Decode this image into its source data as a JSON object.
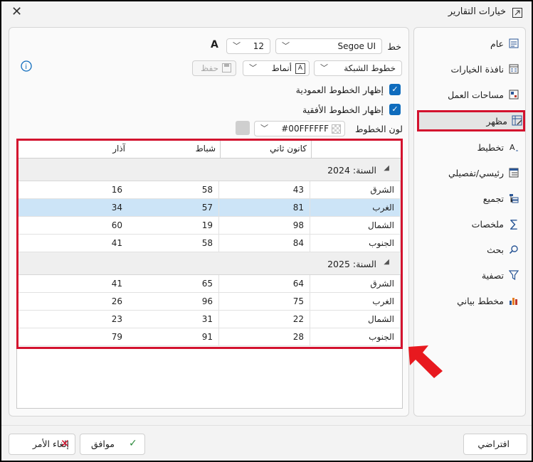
{
  "window": {
    "title": "خيارات التقارير"
  },
  "sidebar": {
    "items": [
      {
        "label": "عام",
        "icon": "general-settings-icon"
      },
      {
        "label": "نافذة الخيارات",
        "icon": "options-window-icon"
      },
      {
        "label": "مساحات العمل",
        "icon": "workspaces-icon"
      },
      {
        "label": "مظهر",
        "icon": "appearance-icon",
        "active": true
      },
      {
        "label": "تخطيط",
        "icon": "layout-icon"
      },
      {
        "label": "رئيسي/تفصيلي",
        "icon": "master-detail-icon"
      },
      {
        "label": "تجميع",
        "icon": "grouping-icon"
      },
      {
        "label": "ملخصات",
        "icon": "summaries-icon"
      },
      {
        "label": "بحث",
        "icon": "search-icon"
      },
      {
        "label": "تصفية",
        "icon": "filter-icon"
      },
      {
        "label": "مخطط بياني",
        "icon": "chart-icon"
      }
    ]
  },
  "appearance": {
    "font_label": "خط",
    "font_value": "Segoe UI",
    "size_value": "12",
    "save_label": "حفظ",
    "gridlines_value": "خطوط الشبكة",
    "styles_label": "أنماط",
    "show_vertical": "إظهار الخطوط العمودية",
    "show_horizontal": "إظهار الخطوط الأفقية",
    "line_color_label": "لون الخطوط",
    "line_color_value": "#00FFFFFF"
  },
  "grid": {
    "columns": [
      "كانون ثاني",
      "شباط",
      "آذار"
    ],
    "groups": [
      {
        "title": "السنة: 2024",
        "rows": [
          {
            "label": "الشرق",
            "values": [
              "43",
              "58",
              "16"
            ]
          },
          {
            "label": "الغرب",
            "values": [
              "81",
              "57",
              "34"
            ],
            "selected": true
          },
          {
            "label": "الشمال",
            "values": [
              "98",
              "19",
              "60"
            ]
          },
          {
            "label": "الجنوب",
            "values": [
              "84",
              "58",
              "41"
            ]
          }
        ]
      },
      {
        "title": "السنة: 2025",
        "rows": [
          {
            "label": "الشرق",
            "values": [
              "64",
              "65",
              "41"
            ]
          },
          {
            "label": "الغرب",
            "values": [
              "75",
              "96",
              "26"
            ]
          },
          {
            "label": "الشمال",
            "values": [
              "22",
              "31",
              "23"
            ]
          },
          {
            "label": "الجنوب",
            "values": [
              "28",
              "91",
              "79"
            ]
          }
        ]
      }
    ]
  },
  "footer": {
    "default_label": "افتراضي",
    "ok_label": "موافق",
    "cancel_label": "إلغاء الأمر"
  },
  "colors": {
    "accent": "#0f6cbd",
    "highlight": "#d3122e",
    "selection": "#cce4f7"
  }
}
